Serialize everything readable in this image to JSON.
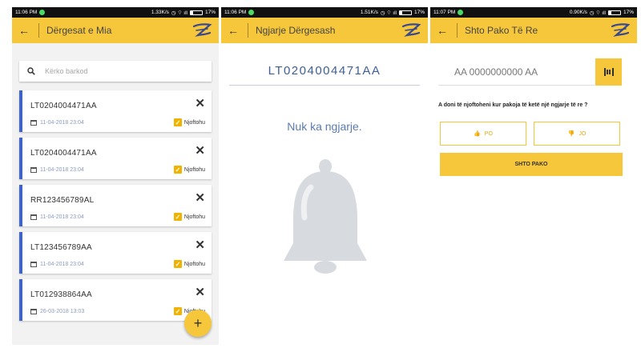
{
  "screens": [
    {
      "status": {
        "time": "11:06 PM",
        "speed": "1.33K/s",
        "battery": "17%"
      },
      "title": "Dërgesat e Mia",
      "search": {
        "placeholder": "Kërko barkod"
      },
      "shipments": [
        {
          "code": "LT0204004471AA",
          "date": "11-04-2018 23:04",
          "notify_label": "Njoftohu"
        },
        {
          "code": "LT0204004471AA",
          "date": "11-04-2018 23:04",
          "notify_label": "Njoftohu"
        },
        {
          "code": "RR123456789AL",
          "date": "11-04-2018 23:04",
          "notify_label": "Njoftohu"
        },
        {
          "code": "LT123456789AA",
          "date": "11-04-2018 23:04",
          "notify_label": "Njoftohu"
        },
        {
          "code": "LT012938864AA",
          "date": "26-03-2018 13:03",
          "notify_label": "Njoftohu"
        }
      ],
      "fab": "+"
    },
    {
      "status": {
        "time": "11:06 PM",
        "speed": "1.51K/s",
        "battery": "17%"
      },
      "title": "Ngjarje Dërgesash",
      "tracking_code": "LT0204004471AA",
      "empty_message": "Nuk ka ngjarje."
    },
    {
      "status": {
        "time": "11:07 PM",
        "speed": "0.90K/s",
        "battery": "17%"
      },
      "title": "Shto Pako Të Re",
      "code_field": {
        "placeholder": "AA 0000000000 AA"
      },
      "question": "A doni të njoftoheni kur pakoja të ketë një ngjarje të re ?",
      "yes_label": "PO",
      "no_label": "JO",
      "add_button": "SHTO PAKO"
    }
  ],
  "colors": {
    "accent": "#f6c63b",
    "card_stripe": "#3f64c7",
    "tracking_text": "#3f5e96"
  }
}
